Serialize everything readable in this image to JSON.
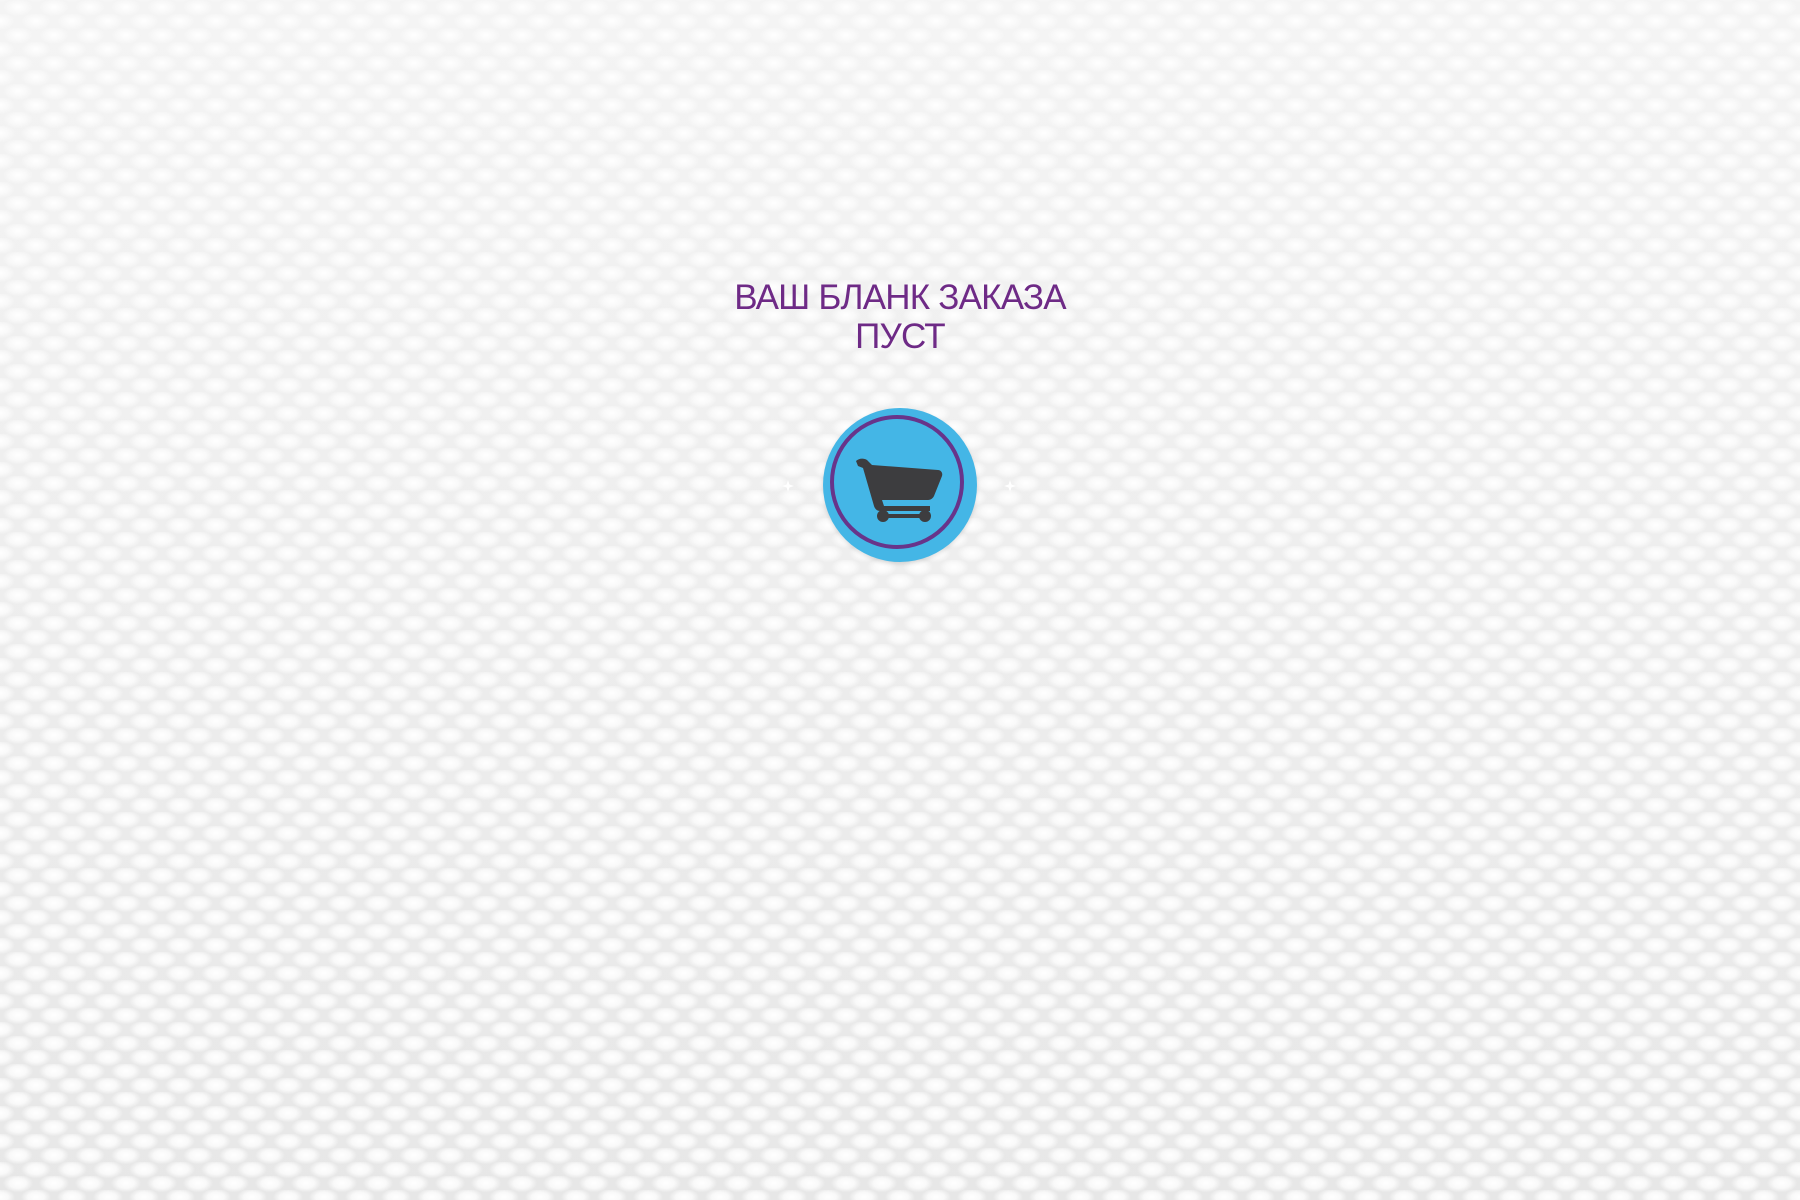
{
  "empty_cart": {
    "title_line_1": "ВАШ БЛАНК ЗАКАЗА",
    "title_line_2": "ПУСТ",
    "icon": "shopping-cart-icon"
  },
  "colors": {
    "title": "#6e2a86",
    "badge_fill": "#44b6e6",
    "badge_ring": "#68348a",
    "cart_icon": "#3d3d3f"
  }
}
